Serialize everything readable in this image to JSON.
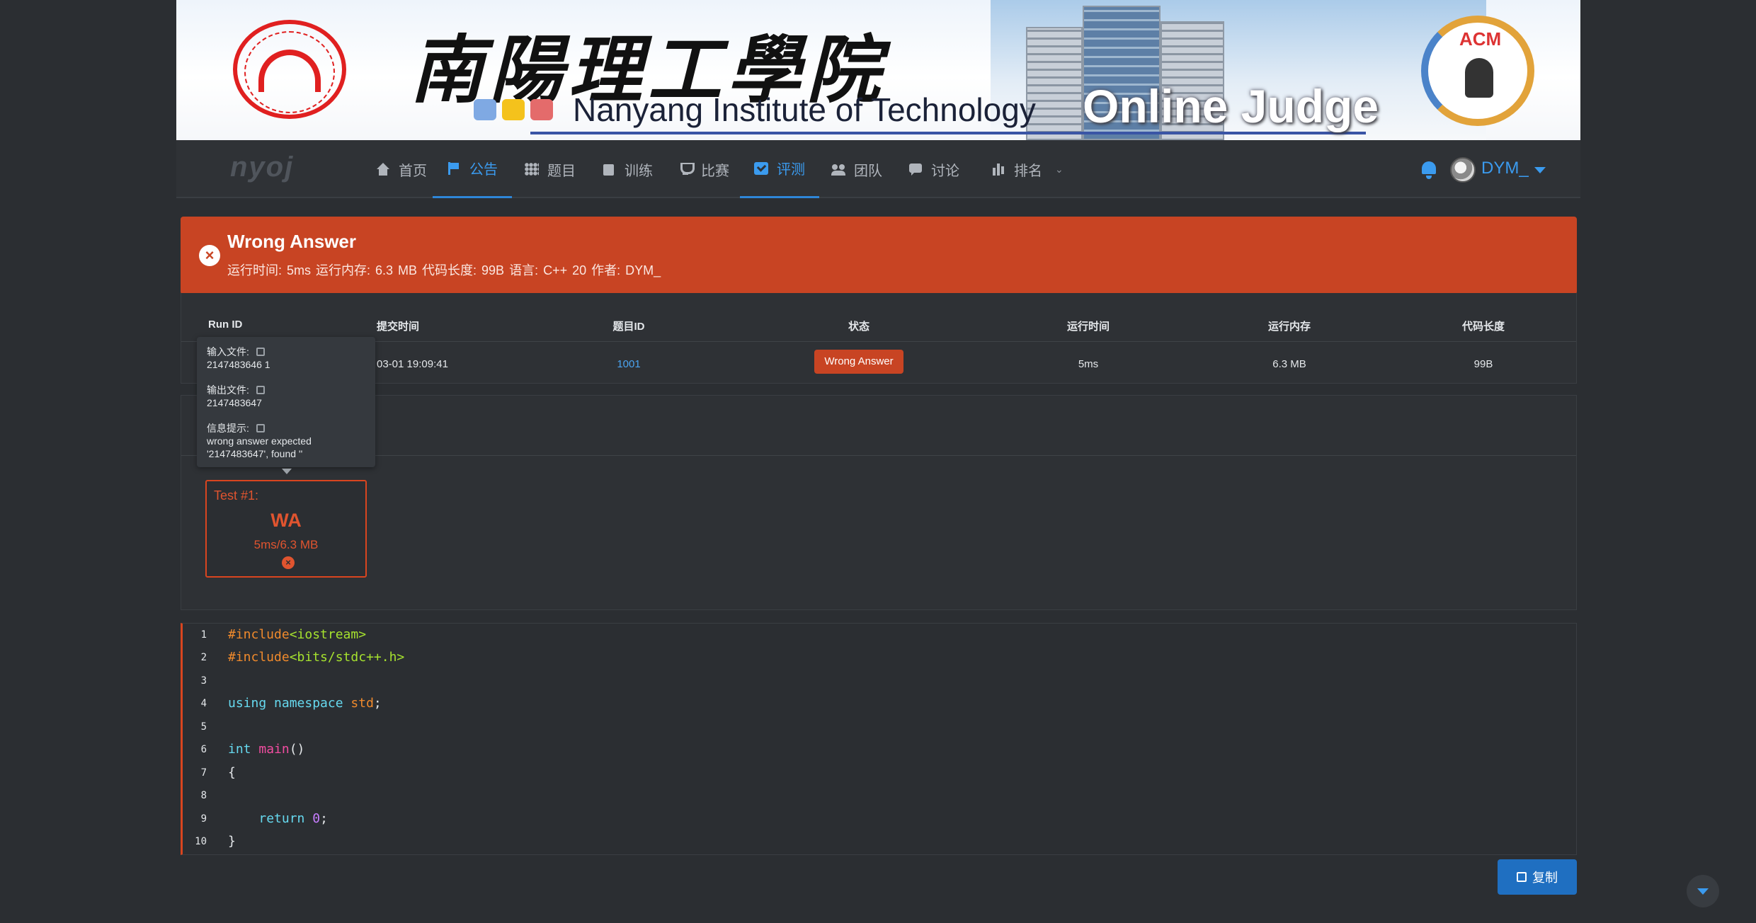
{
  "banner": {
    "calligraphy": "南陽理工學院",
    "institution": "Nanyang Institute of Technology",
    "oj_title": "Online Judge",
    "acm_logo_text": "ACM"
  },
  "nav": {
    "brand": "nyoj",
    "items": [
      {
        "label": "首页",
        "icon": "home-icon"
      },
      {
        "label": "公告",
        "icon": "flag-icon"
      },
      {
        "label": "题目",
        "icon": "grid-icon"
      },
      {
        "label": "训练",
        "icon": "clipboard-icon"
      },
      {
        "label": "比赛",
        "icon": "trophy-icon"
      },
      {
        "label": "评测",
        "icon": "check-square-icon"
      },
      {
        "label": "团队",
        "icon": "users-icon"
      },
      {
        "label": "讨论",
        "icon": "chat-icon"
      },
      {
        "label": "排名",
        "icon": "bar-chart-icon"
      }
    ],
    "username": "DYM_"
  },
  "alert": {
    "title": "Wrong Answer",
    "meta": "运行时间: 5ms   运行内存: 6.3 MB   代码长度: 99B   语言: C++ 20   作者: DYM_"
  },
  "table": {
    "headers": [
      "Run ID",
      "提交时间",
      "题目ID",
      "状态",
      "运行时间",
      "运行内存",
      "代码长度"
    ],
    "row": {
      "submit_time": "03-01 19:09:41",
      "problem_id": "1001",
      "status": "Wrong Answer",
      "time": "5ms",
      "memory": "6.3 MB",
      "code_length": "99B"
    }
  },
  "tooltip": {
    "input_label": "输入文件:",
    "input_value": "2147483646 1",
    "output_label": "输出文件:",
    "output_value": "2147483647",
    "info_label": "信息提示:",
    "info_value": "wrong answer expected '2147483647', found ''"
  },
  "test_case": {
    "name": "Test #1:",
    "result": "WA",
    "stats": "5ms/6.3 MB"
  },
  "code": {
    "line_numbers": [
      "1",
      "2",
      "3",
      "4",
      "5",
      "6",
      "7",
      "8",
      "9",
      "10"
    ],
    "l1_pre": "#include",
    "l1_inc": "<iostream>",
    "l2_pre": "#include",
    "l2_inc": "<bits/stdc++.h>",
    "l4_kw": "using namespace",
    "l4_ns": "std",
    "l4_end": ";",
    "l6_kw": "int",
    "l6_fn": "main",
    "l6_end": "()",
    "l7": "{",
    "l9_kw": "return",
    "l9_num": "0",
    "l9_end": ";",
    "l10": "}"
  },
  "copy_button": "复制",
  "colors": {
    "page_bg": "#2b2e32",
    "accent": "#3b9bef",
    "error": "#c84423",
    "button": "#1f6fc1"
  }
}
